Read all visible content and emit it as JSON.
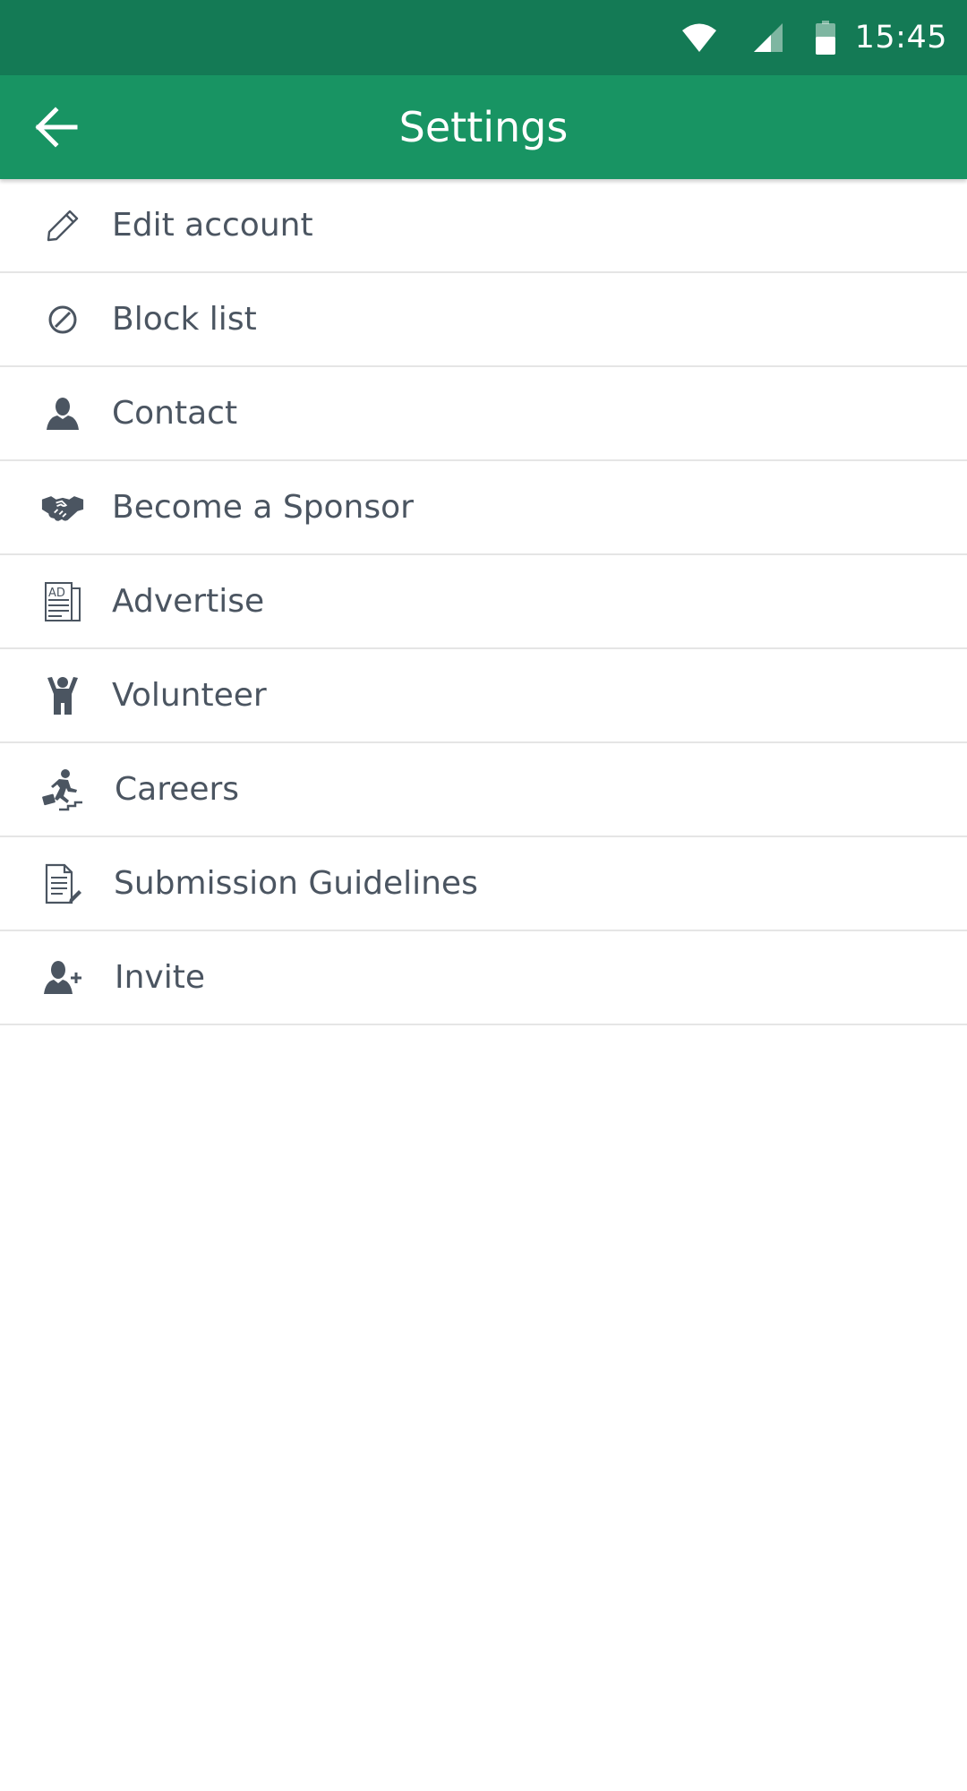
{
  "status_bar": {
    "time": "15:45",
    "background_color": "#147a55",
    "icons": [
      "wifi-icon",
      "signal-icon",
      "battery-icon"
    ]
  },
  "app_bar": {
    "title": "Settings",
    "background_color": "#189463",
    "back_icon": "arrow-left-icon"
  },
  "settings": {
    "items": [
      {
        "label": "Edit account",
        "icon": "pencil-icon"
      },
      {
        "label": "Block list",
        "icon": "block-icon"
      },
      {
        "label": "Contact",
        "icon": "person-icon"
      },
      {
        "label": "Become a Sponsor",
        "icon": "handshake-icon"
      },
      {
        "label": "Advertise",
        "icon": "ad-newspaper-icon"
      },
      {
        "label": "Volunteer",
        "icon": "volunteer-icon"
      },
      {
        "label": "Careers",
        "icon": "career-climb-icon"
      },
      {
        "label": "Submission Guidelines",
        "icon": "document-icon"
      },
      {
        "label": "Invite",
        "icon": "add-person-icon"
      }
    ]
  },
  "colors": {
    "text": "#4b5561",
    "icon": "#4b5561",
    "divider": "#e5e5e5"
  }
}
